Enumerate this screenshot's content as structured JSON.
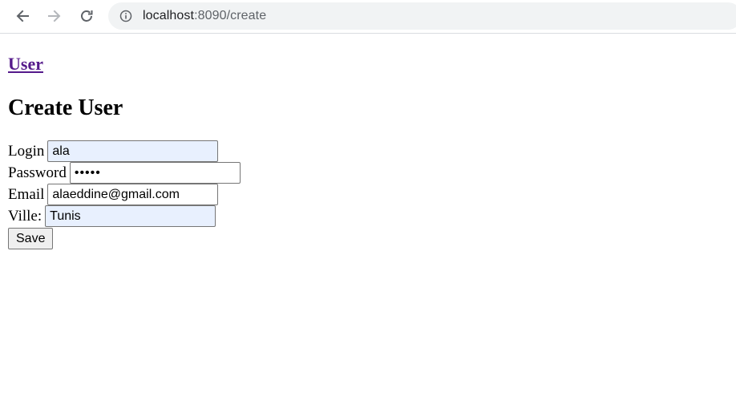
{
  "browser": {
    "url_host": "localhost",
    "url_path": ":8090/create",
    "icons": {
      "back": "arrow-left-icon",
      "forward": "arrow-right-icon",
      "reload": "reload-icon",
      "site_info": "info-icon"
    }
  },
  "page": {
    "brand_link": "User",
    "title": "Create User",
    "form": {
      "login": {
        "label": "Login",
        "value": "ala"
      },
      "password": {
        "label": "Password",
        "value": "•••••"
      },
      "email": {
        "label": "Email",
        "value": "alaeddine@gmail.com"
      },
      "ville": {
        "label": "Ville:",
        "value": "Tunis"
      },
      "save_label": "Save"
    }
  },
  "colors": {
    "link_visited": "#551a8b",
    "autofill_bg": "#e8f0fe",
    "omnibox_bg": "#f1f3f4"
  }
}
